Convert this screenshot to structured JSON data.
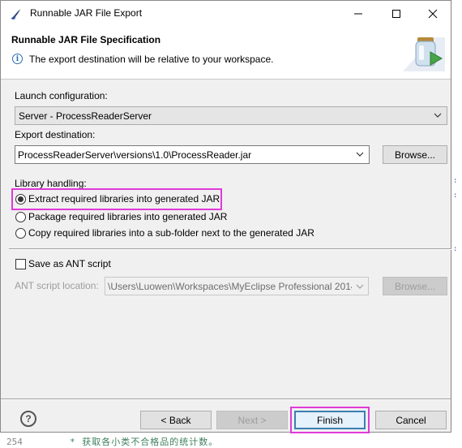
{
  "window": {
    "title": "Runnable JAR File Export",
    "minimize_icon": "minimize-icon",
    "maximize_icon": "maximize-icon",
    "close_icon": "close-icon"
  },
  "banner": {
    "title": "Runnable JAR File Specification",
    "message": "The export destination will be relative to your workspace.",
    "icon": "info-icon",
    "wizard_icon": "jar-export-wizard-icon"
  },
  "form": {
    "launch_label": "Launch configuration:",
    "launch_value": "Server - ProcessReaderServer",
    "export_label": "Export destination:",
    "export_value": "ProcessReaderServer\\versions\\1.0\\ProcessReader.jar",
    "browse_label": "Browse...",
    "library_label": "Library handling:",
    "library_options": [
      {
        "label": "Extract required libraries into generated JAR",
        "selected": true
      },
      {
        "label": "Package required libraries into generated JAR",
        "selected": false
      },
      {
        "label": "Copy required libraries into a sub-folder next to the generated JAR",
        "selected": false
      }
    ],
    "ant_checkbox_label": "Save as ANT script",
    "ant_checked": false,
    "ant_location_label": "ANT script location:",
    "ant_location_value": "\\Users\\Luowen\\Workspaces\\MyEclipse Professional 2014",
    "ant_browse_label": "Browse..."
  },
  "footer": {
    "help_icon": "help-icon",
    "back_label": "< Back",
    "next_label": "Next >",
    "finish_label": "Finish",
    "cancel_label": "Cancel"
  },
  "background": {
    "line_number": "254",
    "comment": "* 获取各小类不合格品的统计数。"
  },
  "colors": {
    "highlight": "#e03ad8",
    "default_button_border": "#3c7fb1"
  }
}
